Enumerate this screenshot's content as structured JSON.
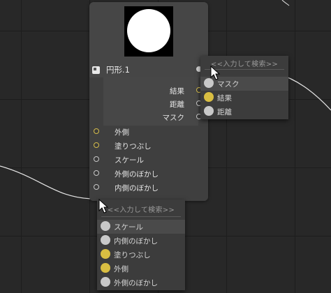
{
  "colors": {
    "background": "#282828",
    "node": "#464646",
    "socket_yellow": "#d9be42",
    "socket_gray": "#c9c9c9",
    "wire": "#e6e6e6"
  },
  "node": {
    "title": "円形.1",
    "preview": "white-circle-on-black",
    "outputs": [
      "結果",
      "距離",
      "マスク"
    ],
    "inputs": [
      {
        "label": "外側",
        "socket": "yellow"
      },
      {
        "label": "塗りつぶし",
        "socket": "yellow"
      },
      {
        "label": "スケール",
        "socket": "gray"
      },
      {
        "label": "外側のぼかし",
        "socket": "gray"
      },
      {
        "label": "内側のぼかし",
        "socket": "gray"
      }
    ]
  },
  "output_popup": {
    "search_placeholder": "<<入力して検索>>",
    "items": [
      {
        "label": "マスク",
        "socket": "gray"
      },
      {
        "label": "結果",
        "socket": "yellow"
      },
      {
        "label": "距離",
        "socket": "gray"
      }
    ]
  },
  "input_popup": {
    "search_placeholder": "<<入力して検索>>",
    "items": [
      {
        "label": "スケール",
        "socket": "gray"
      },
      {
        "label": "内側のぼかし",
        "socket": "gray"
      },
      {
        "label": "塗りつぶし",
        "socket": "yellow"
      },
      {
        "label": "外側",
        "socket": "yellow"
      },
      {
        "label": "外側のぼかし",
        "socket": "gray"
      }
    ]
  }
}
